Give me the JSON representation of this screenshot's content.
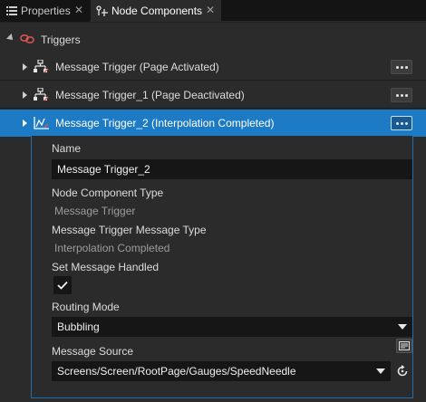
{
  "tabs": [
    {
      "label": "Properties",
      "icon": "list-icon"
    },
    {
      "label": "Node Components",
      "icon": "node-components-icon"
    }
  ],
  "group": {
    "label": "Triggers",
    "icon": "trigger-link-icon"
  },
  "triggers": [
    {
      "label": "Message Trigger (Page Activated)",
      "icon": "message-trigger-icon"
    },
    {
      "label": "Message Trigger_1 (Page Deactivated)",
      "icon": "message-trigger-icon"
    },
    {
      "label": "Message Trigger_2 (Interpolation Completed)",
      "icon": "interpolation-trigger-icon",
      "selected": true
    }
  ],
  "details": {
    "name_label": "Name",
    "name_value": "Message Trigger_2",
    "type_label": "Node Component Type",
    "type_value": "Message Trigger",
    "msg_type_label": "Message Trigger Message Type",
    "msg_type_value": "Interpolation Completed",
    "handled_label": "Set Message Handled",
    "handled_checked": true,
    "routing_label": "Routing Mode",
    "routing_value": "Bubbling",
    "source_label": "Message Source",
    "source_value": "Screens/Screen/RootPage/Gauges/SpeedNeedle"
  },
  "colors": {
    "selection": "#1d7ac4",
    "accent_border": "#1c70b5",
    "trigger_icon": "#e05555"
  }
}
